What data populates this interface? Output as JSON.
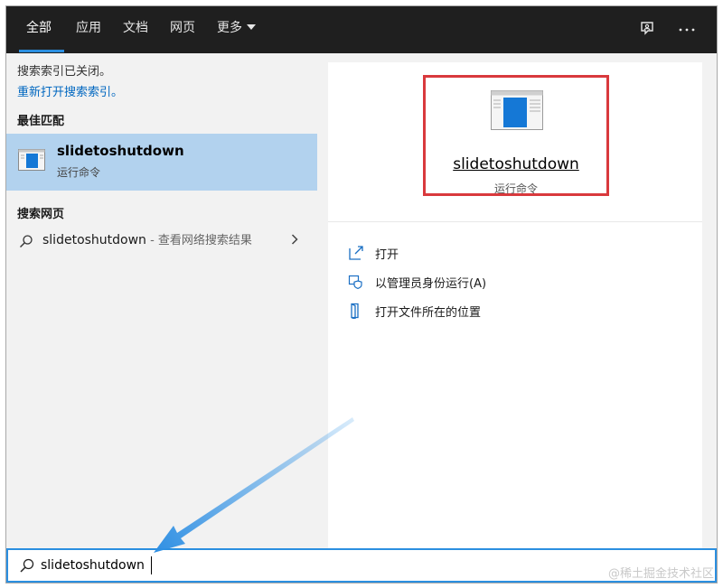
{
  "tabs": [
    {
      "label": "全部",
      "active": true
    },
    {
      "label": "应用"
    },
    {
      "label": "文档"
    },
    {
      "label": "网页"
    },
    {
      "label": "更多"
    }
  ],
  "top_icons": [
    "feedback-icon",
    "more-options-icon"
  ],
  "index": {
    "off_text": "搜索索引已关闭。",
    "link_text": "重新打开搜索索引。"
  },
  "best_match": {
    "section_title": "最佳匹配",
    "title": "slidetoshutdown",
    "subtitle": "运行命令"
  },
  "web": {
    "section_title": "搜索网页",
    "query": "slidetoshutdown",
    "suffix": " - 查看网络搜索结果"
  },
  "detail": {
    "title": "slidetoshutdown",
    "subtitle": "运行命令",
    "highlight_color": "#d9393d"
  },
  "actions": [
    {
      "label": "打开",
      "icon": "open-icon"
    },
    {
      "label": "以管理员身份运行(A)",
      "icon": "shield-icon"
    },
    {
      "label": "打开文件所在的位置",
      "icon": "file-location-icon"
    }
  ],
  "search": {
    "value": "slidetoshutdown"
  },
  "colors": {
    "accent": "#2b8fe0",
    "selection": "#b2d2ee",
    "topbar": "#1f1f1f"
  },
  "watermark": "@稀土掘金技术社区"
}
